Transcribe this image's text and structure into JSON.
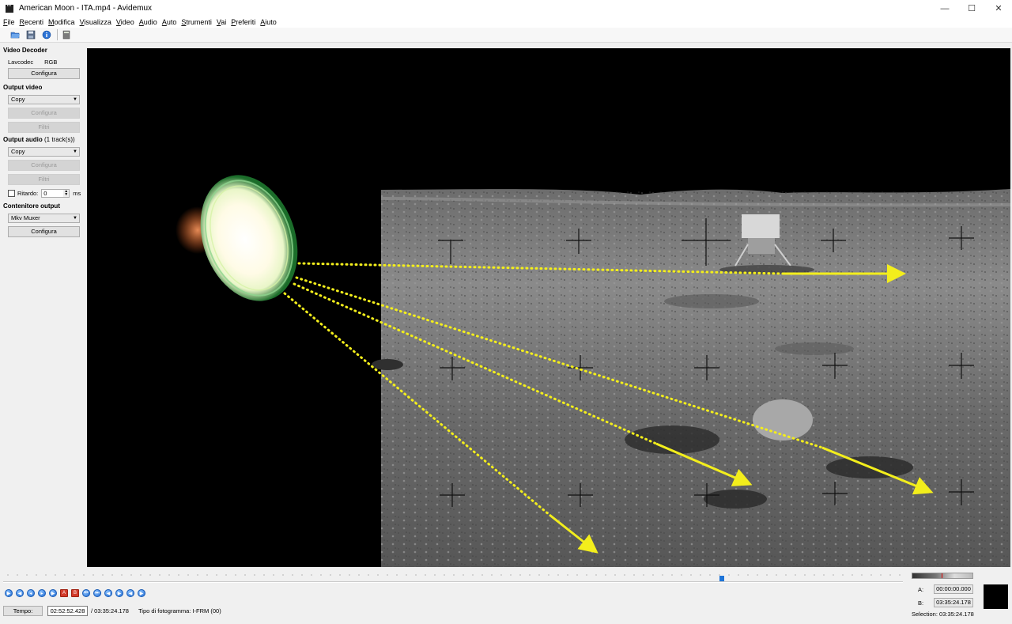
{
  "window": {
    "title": "American Moon - ITA.mp4 - Avidemux",
    "controls": {
      "minimize": "—",
      "maximize": "☐",
      "close": "✕"
    }
  },
  "menu": [
    "File",
    "Recenti",
    "Modifica",
    "Visualizza",
    "Video",
    "Audio",
    "Auto",
    "Strumenti",
    "Vai",
    "Preferiti",
    "Aiuto"
  ],
  "toolbar": {
    "icons": [
      "open-icon",
      "save-icon",
      "info-icon",
      "calculator-icon"
    ]
  },
  "left_panel": {
    "video_decoder": {
      "title": "Video Decoder",
      "codec": "Lavcodec",
      "format": "RGB",
      "configure": "Configura"
    },
    "output_video": {
      "title": "Output video",
      "selected": "Copy",
      "configure": "Configura",
      "filters": "Filtri"
    },
    "output_audio": {
      "title": "Output audio",
      "tracks": "(1 track(s))",
      "selected": "Copy",
      "configure": "Configura",
      "filters": "Filtri",
      "delay_label": "Ritardo:",
      "delay_value": "0",
      "delay_unit": "ms"
    },
    "container": {
      "title": "Contenitore output",
      "selected": "Mkv Muxer",
      "configure": "Configura"
    }
  },
  "playback": {
    "position_fraction": 0.8,
    "buttons": [
      "play",
      "rewind",
      "back-one-frame",
      "forward-one-frame",
      "forward",
      "set-marker-a",
      "set-marker-b",
      "prev-keyframe",
      "next-keyframe",
      "goto-marker-a",
      "goto-marker-b",
      "prev-black",
      "next-black"
    ]
  },
  "status": {
    "time_button": "Tempo:",
    "current_time": "02:52:52.428",
    "total_time": "/ 03:35:24.178",
    "frame_type": "Tipo di fotogramma: I-FRM (00)",
    "marker_a_label": "A:",
    "marker_a": "00:00:00.000",
    "marker_b_label": "B:",
    "marker_b": "03:35:24.178",
    "selection": "Selection: 03:35:24.178"
  },
  "colors": {
    "accent": "#1d74d8",
    "arrow": "#f3ee1c"
  }
}
